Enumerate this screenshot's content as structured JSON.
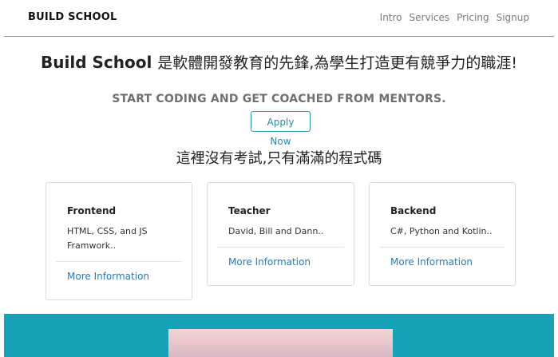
{
  "nav": {
    "brand": "BUILD SCHOOL",
    "links": [
      "Intro",
      "Services",
      "Pricing",
      "Signup"
    ]
  },
  "hero": {
    "title_en": "Build School",
    "title_cn": "是軟體開發教育的先鋒,為學生打造更有競爭力的職涯!",
    "subtitle": "START CODING AND GET COACHED FROM MENTORS.",
    "apply_label": "Apply Now",
    "motto": "這裡沒有考試,只有滿滿的程式碼"
  },
  "cards": [
    {
      "title": "Frontend",
      "text": "HTML, CSS, and JS Framwork..",
      "link": "More Information"
    },
    {
      "title": "Teacher",
      "text": "David, Bill and Dann..",
      "link": "More Information"
    },
    {
      "title": "Backend",
      "text": "C#, Python and Kotlin..",
      "link": "More Information"
    }
  ],
  "colors": {
    "accent": "#17a2b8",
    "link": "#2a7ab8",
    "nav_link": "#7a7a7a"
  }
}
